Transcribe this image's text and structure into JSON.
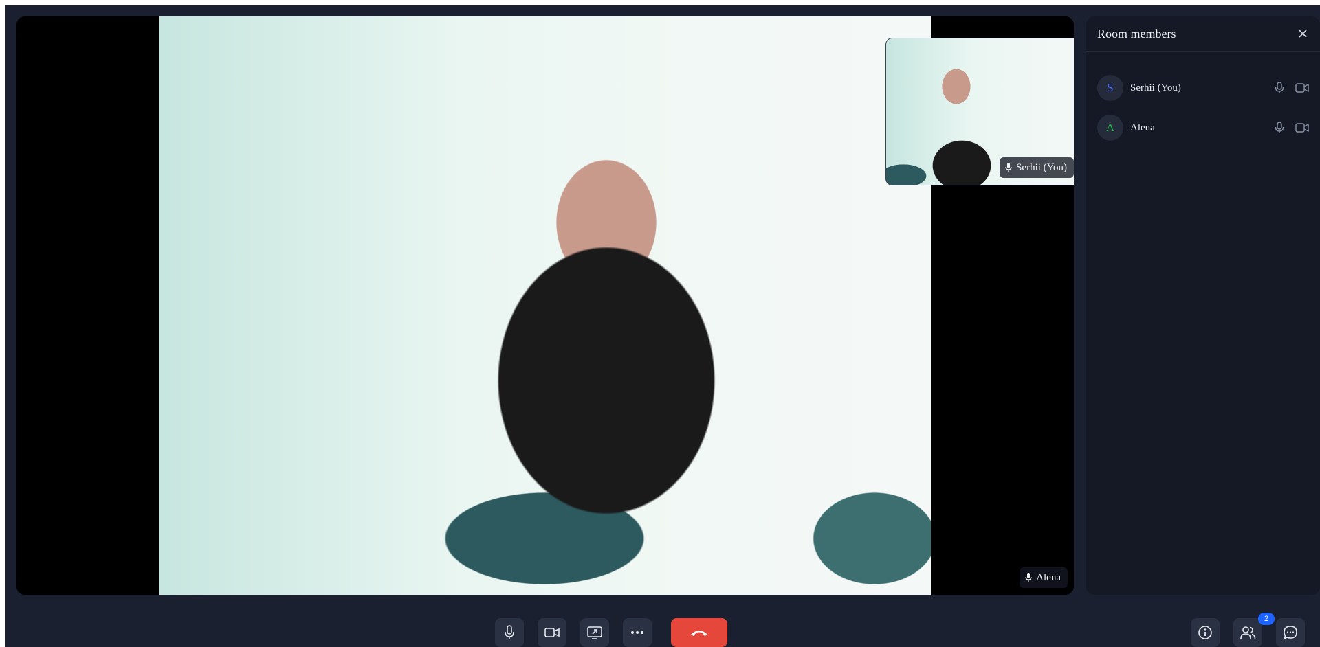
{
  "main_video": {
    "participant_name": "Alena"
  },
  "self_view": {
    "participant_name": "Serhii (You)"
  },
  "members_panel": {
    "title": "Room members",
    "members": [
      {
        "initial": "S",
        "name": "Serhii (You)",
        "initial_color": "#4a6cf7"
      },
      {
        "initial": "A",
        "name": "Alena",
        "initial_color": "#22b04b"
      }
    ]
  },
  "toolbar": {
    "left_buttons": [
      "microphone-icon",
      "camera-icon",
      "share-screen-icon",
      "more-icon"
    ],
    "leave_button_color": "#e5483b",
    "right_buttons": [
      "info-icon",
      "people-icon",
      "chat-icon"
    ],
    "members_count": "2"
  }
}
